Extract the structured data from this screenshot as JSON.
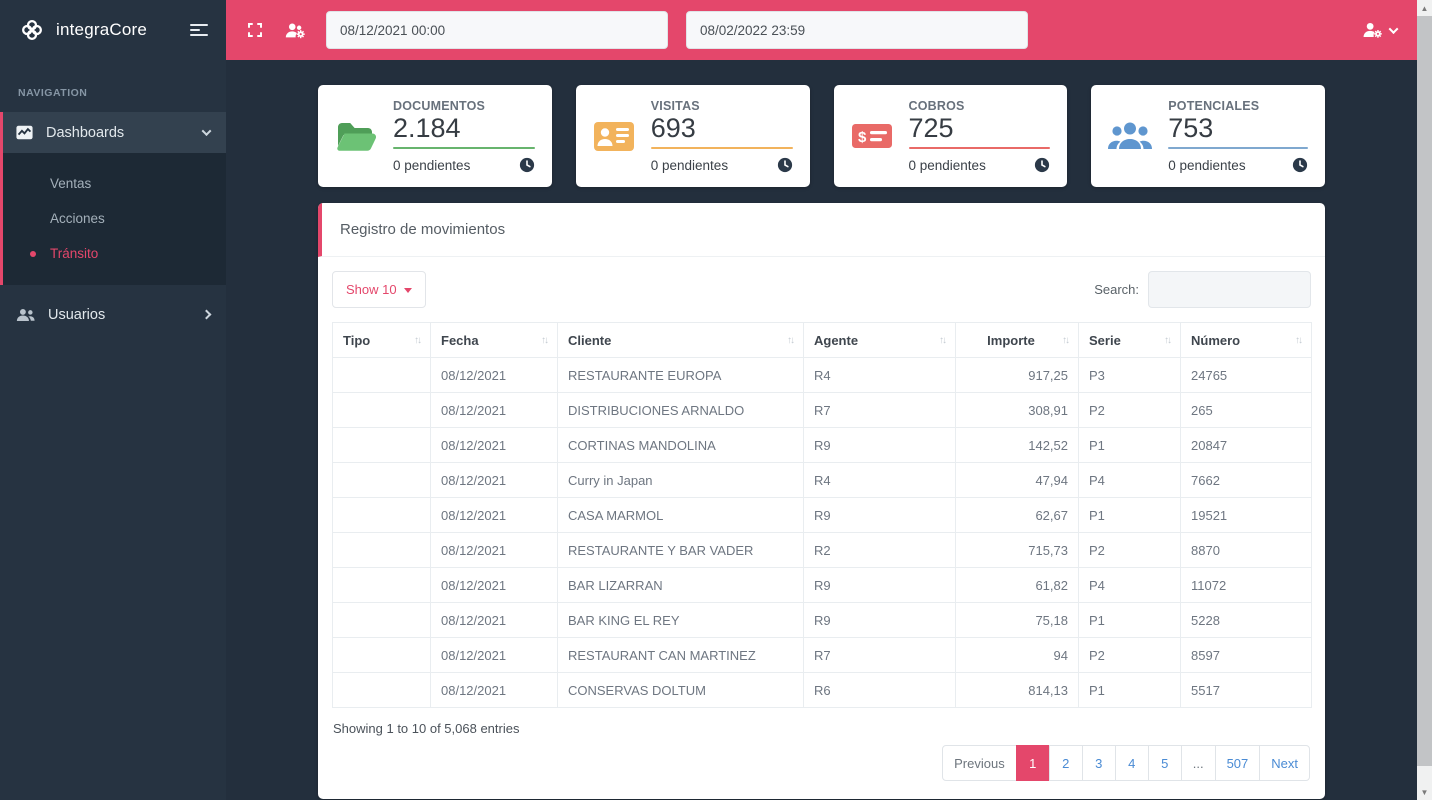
{
  "app": {
    "brand": "integraCore"
  },
  "colors": {
    "accent": "#e4476b",
    "sidebar": "#263341",
    "main_bg": "#232f3d"
  },
  "sidebar": {
    "section_label": "NAVIGATION",
    "dashboards": {
      "label": "Dashboards",
      "icon": "chart-icon"
    },
    "submenu": [
      {
        "label": "Ventas",
        "active": false
      },
      {
        "label": "Acciones",
        "active": false
      },
      {
        "label": "Tránsito",
        "active": true
      }
    ],
    "usuarios": {
      "label": "Usuarios",
      "icon": "users-icon"
    }
  },
  "topbar": {
    "icons": [
      "fullscreen-icon",
      "users-cog-icon",
      "user-gear-icon"
    ],
    "date_from": "08/12/2021 00:00",
    "date_to": "08/02/2022 23:59"
  },
  "cards": [
    {
      "label": "DOCUMENTOS",
      "value": "2.184",
      "sub": "0 pendientes",
      "icon": "folder-open-icon",
      "color": "#67b46d"
    },
    {
      "label": "VISITAS",
      "value": "693",
      "sub": "0 pendientes",
      "icon": "id-card-icon",
      "color": "#f2b35c"
    },
    {
      "label": "COBROS",
      "value": "725",
      "sub": "0 pendientes",
      "icon": "money-check-icon",
      "color": "#e96a67"
    },
    {
      "label": "POTENCIALES",
      "value": "753",
      "sub": "0 pendientes",
      "icon": "users-group-icon",
      "color": "#7fa8cf"
    }
  ],
  "panel": {
    "title": "Registro de movimientos",
    "show_button": "Show 10",
    "search_label": "Search:",
    "search_value": "",
    "table": {
      "columns": [
        "Tipo",
        "Fecha",
        "Cliente",
        "Agente",
        "Importe",
        "Serie",
        "Número"
      ],
      "rows": [
        [
          "",
          "08/12/2021",
          "RESTAURANTE EUROPA",
          "R4",
          "917,25",
          "P3",
          "24765"
        ],
        [
          "",
          "08/12/2021",
          "DISTRIBUCIONES ARNALDO",
          "R7",
          "308,91",
          "P2",
          "265"
        ],
        [
          "",
          "08/12/2021",
          "CORTINAS MANDOLINA",
          "R9",
          "142,52",
          "P1",
          "20847"
        ],
        [
          "",
          "08/12/2021",
          "Curry in Japan",
          "R4",
          "47,94",
          "P4",
          "7662"
        ],
        [
          "",
          "08/12/2021",
          "CASA MARMOL",
          "R9",
          "62,67",
          "P1",
          "19521"
        ],
        [
          "",
          "08/12/2021",
          "RESTAURANTE Y BAR VADER",
          "R2",
          "715,73",
          "P2",
          "8870"
        ],
        [
          "",
          "08/12/2021",
          "BAR LIZARRAN",
          "R9",
          "61,82",
          "P4",
          "11072"
        ],
        [
          "",
          "08/12/2021",
          "BAR KING EL REY",
          "R9",
          "75,18",
          "P1",
          "5228"
        ],
        [
          "",
          "08/12/2021",
          "RESTAURANT CAN MARTINEZ",
          "R7",
          "94",
          "P2",
          "8597"
        ],
        [
          "",
          "08/12/2021",
          "CONSERVAS DOLTUM",
          "R6",
          "814,13",
          "P1",
          "5517"
        ]
      ]
    },
    "footer": {
      "summary": "Showing 1 to 10 of 5,068 entries",
      "pages": [
        {
          "label": "Previous",
          "type": "prev",
          "active": false
        },
        {
          "label": "1",
          "type": "num",
          "active": true
        },
        {
          "label": "2",
          "type": "num",
          "active": false
        },
        {
          "label": "3",
          "type": "num",
          "active": false
        },
        {
          "label": "4",
          "type": "num",
          "active": false
        },
        {
          "label": "5",
          "type": "num",
          "active": false
        },
        {
          "label": "...",
          "type": "ellipsis",
          "active": false
        },
        {
          "label": "507",
          "type": "num",
          "active": false
        },
        {
          "label": "Next",
          "type": "next",
          "active": false
        }
      ]
    }
  }
}
